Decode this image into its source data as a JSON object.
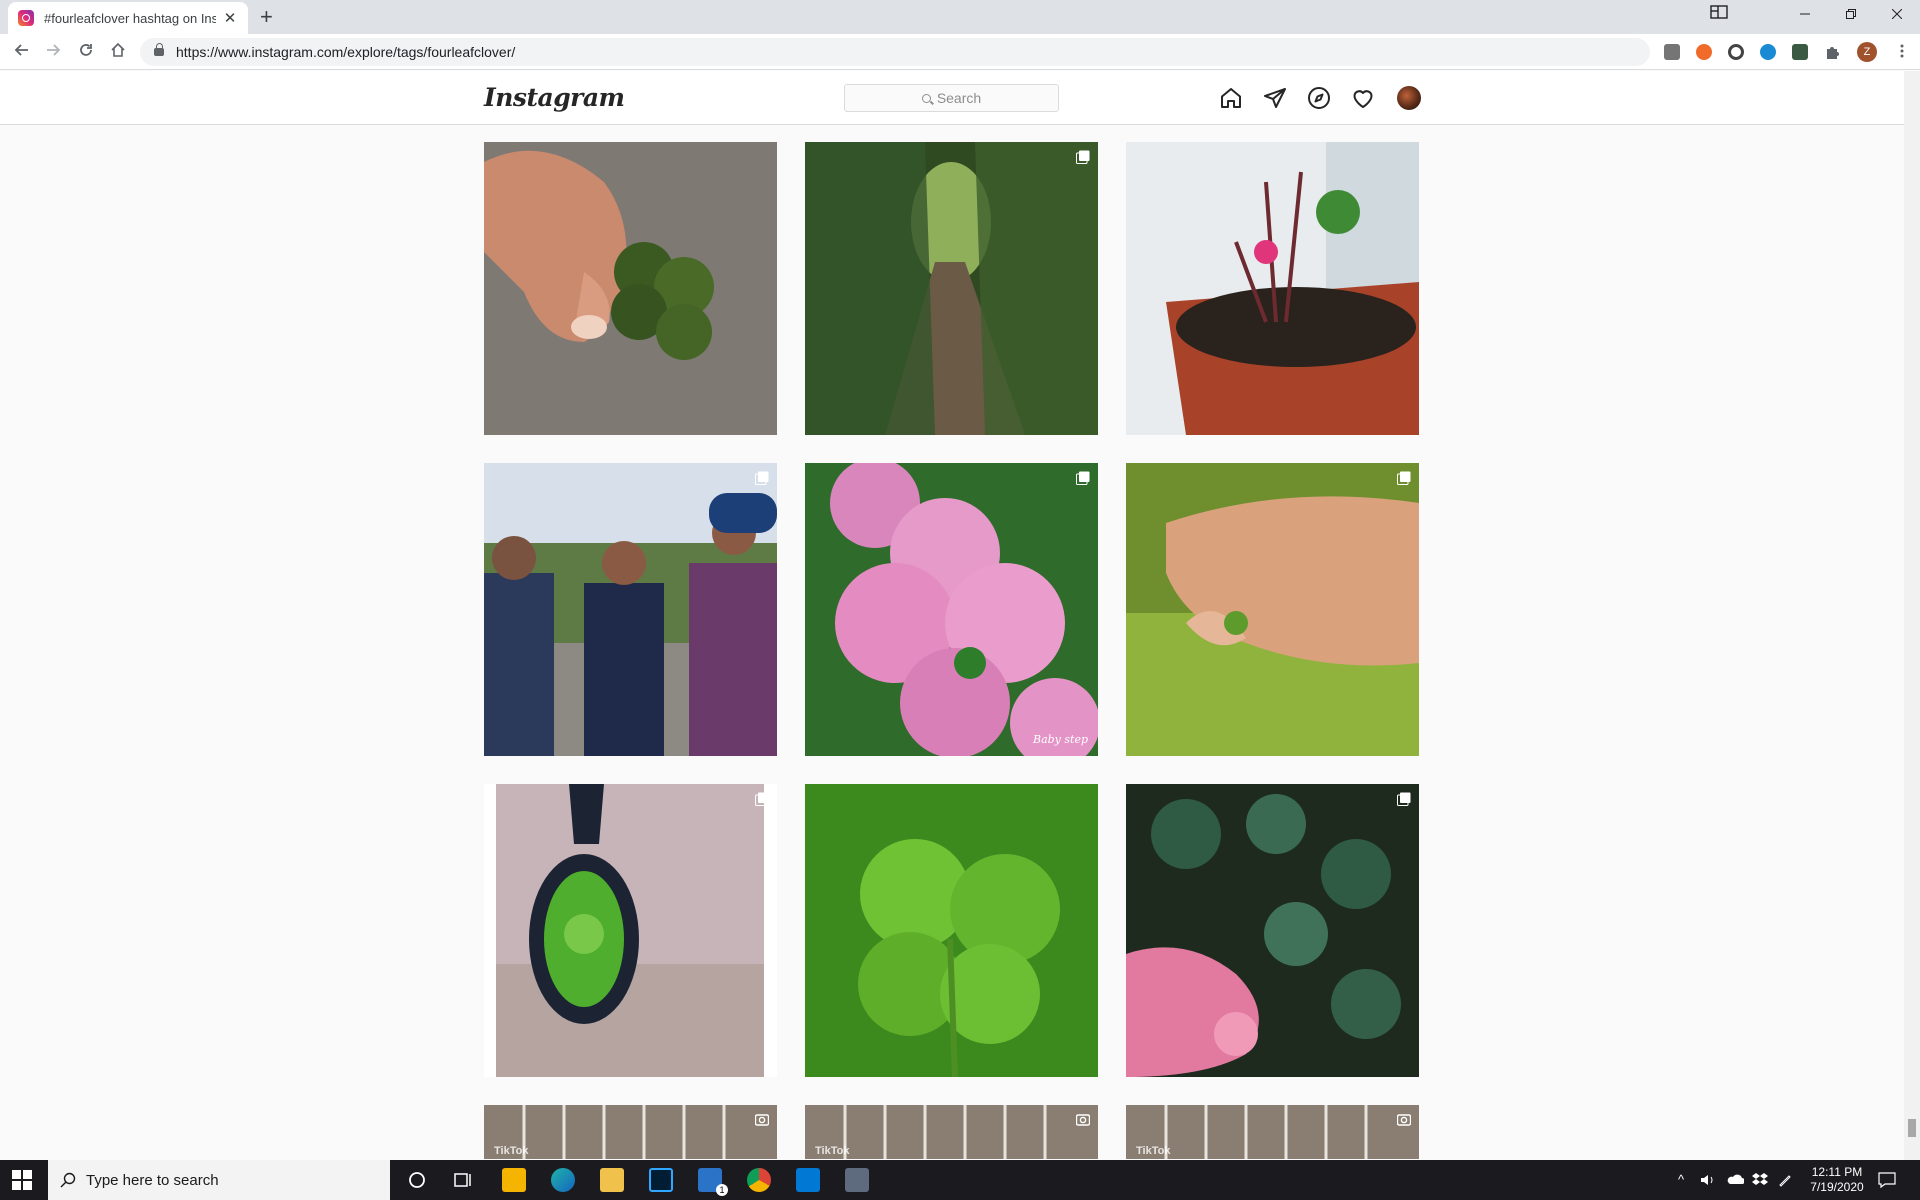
{
  "browser": {
    "tab_title": "#fourleafclover hashtag on Instag",
    "tab_close": "✕",
    "new_tab": "+",
    "url": "https://www.instagram.com/explore/tags/fourleafclover/",
    "profile_initial": "Z"
  },
  "instagram": {
    "logo": "Instagram",
    "search_placeholder": "Search",
    "watermark": "Baby step"
  },
  "posts": [
    {
      "subject": "hand holding four-leaf clover",
      "badge": "none"
    },
    {
      "subject": "forest path",
      "badge": "carousel"
    },
    {
      "subject": "potted clover plant",
      "badge": "none"
    },
    {
      "subject": "three friends outdoors",
      "badge": "carousel"
    },
    {
      "subject": "pink hydrangea with clover",
      "badge": "carousel"
    },
    {
      "subject": "hand picking clover in grass",
      "badge": "carousel"
    },
    {
      "subject": "clover pendant necklace",
      "badge": "carousel"
    },
    {
      "subject": "four-leaf clover with dew",
      "badge": "none"
    },
    {
      "subject": "clover and fingers",
      "badge": "carousel"
    },
    {
      "subject": "TikTok video",
      "badge": "video"
    },
    {
      "subject": "TikTok video",
      "badge": "video"
    },
    {
      "subject": "TikTok video",
      "badge": "video"
    }
  ],
  "tiktok_label": "TikTok",
  "taskbar": {
    "search_placeholder": "Type here to search",
    "mail_badge": "1",
    "time": "12:11 PM",
    "date": "7/19/2020"
  },
  "colors": {
    "ig_border": "#dbdbdb",
    "page_bg": "#fafafa",
    "taskbar_bg": "#1b1b1f"
  }
}
